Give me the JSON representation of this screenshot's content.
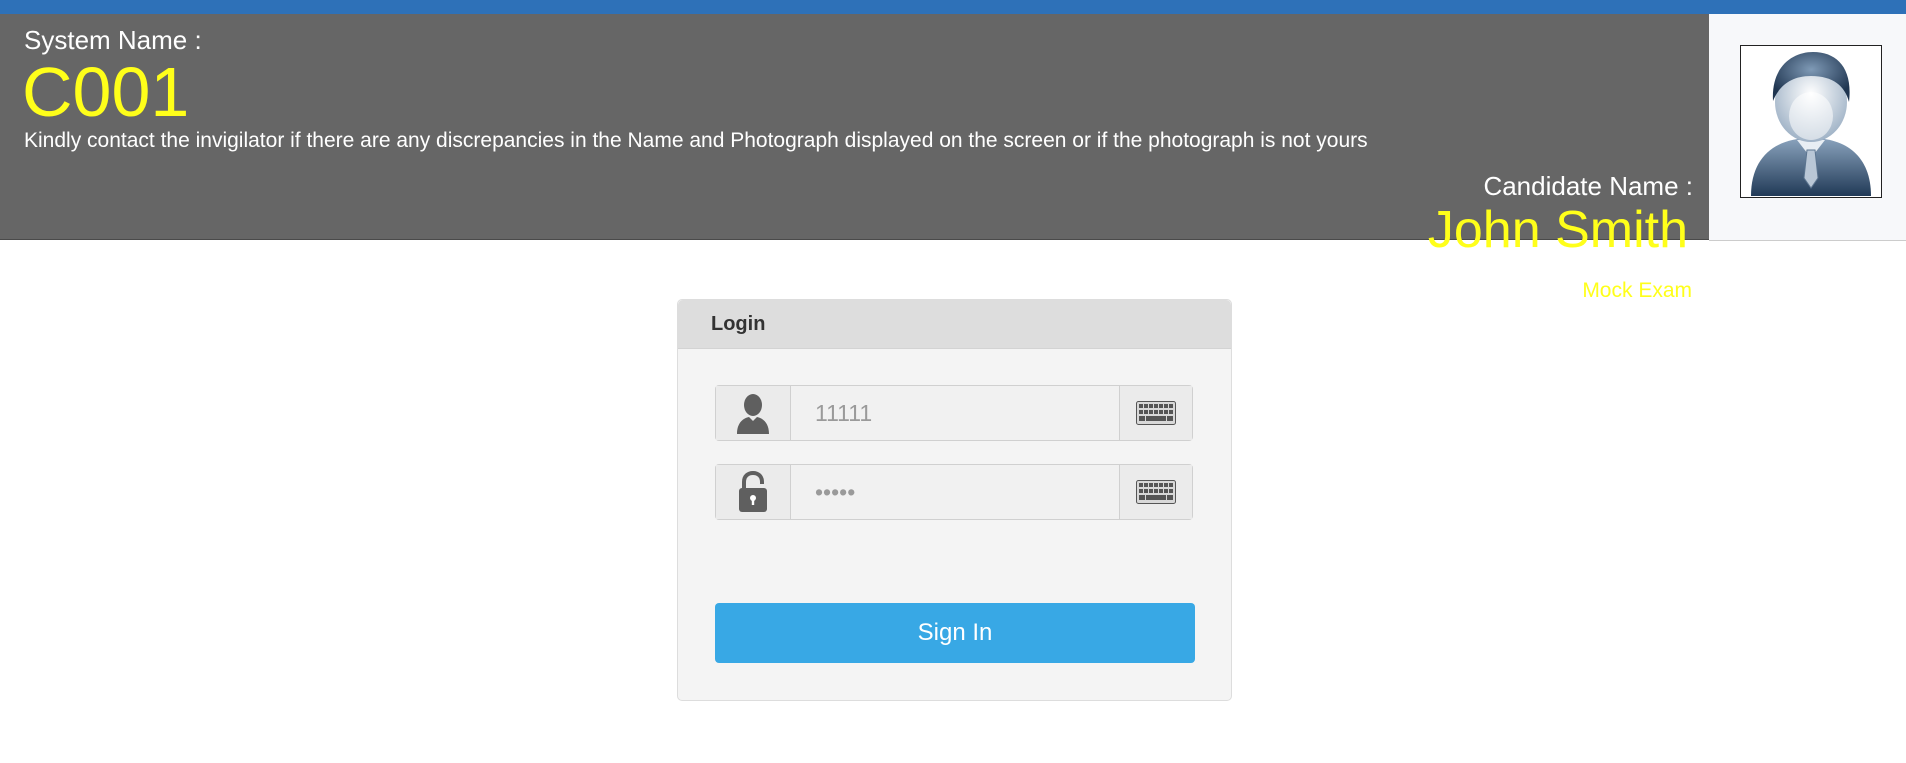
{
  "header": {
    "system_label": "System Name :",
    "system_code": "C001",
    "notice": "Kindly contact the invigilator if there are any discrepancies in the Name and Photograph displayed on the screen or if the photograph is not yours",
    "candidate_label": "Candidate Name :",
    "candidate_name": "John Smith",
    "exam_name": "Mock Exam"
  },
  "login": {
    "title": "Login",
    "username_placeholder": "11111",
    "password_placeholder": "•••••",
    "signin_label": "Sign In"
  },
  "colors": {
    "top_bar": "#2e71b8",
    "header_bg": "#666666",
    "highlight_text": "#ffff1a",
    "signin_button": "#38a8e5"
  },
  "icons": {
    "username": "user-icon",
    "password": "lock-icon",
    "keyboard": "keyboard-icon",
    "avatar": "avatar-icon"
  }
}
